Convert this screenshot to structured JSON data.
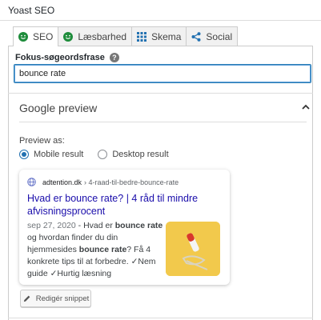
{
  "panel": {
    "title": "Yoast SEO"
  },
  "tabs": [
    {
      "label": "SEO",
      "icon": "smiley-icon",
      "active": true
    },
    {
      "label": "Læsbarhed",
      "icon": "smiley-icon"
    },
    {
      "label": "Skema",
      "icon": "grid-icon"
    },
    {
      "label": "Social",
      "icon": "share-icon"
    }
  ],
  "focus_keyphrase": {
    "label": "Fokus-søgeordsfrase",
    "value": "bounce rate",
    "help_icon": "question-icon"
  },
  "google_preview": {
    "heading": "Google preview",
    "preview_as_label": "Preview as:",
    "options": [
      "Mobile result",
      "Desktop result"
    ],
    "selected": "Mobile result",
    "snippet": {
      "domain": "adtention.dk",
      "path": "› 4-raad-til-bedre-bounce-rate",
      "title": "Hvad er bounce rate? | 4 råd til mindre afvisningsprocent",
      "date": "sep 27, 2020",
      "dash": " - ",
      "desc_1": "Hvad er ",
      "bold_1": "bounce rate",
      "desc_2": " og hvordan finder du din hjemmesides ",
      "bold_2": "bounce rate",
      "desc_3": "? Få 4 konkrete tips til at forbedre. ✓Nem guide ✓Hurtig læsning"
    },
    "edit_button": "Redigér snippet"
  },
  "colors": {
    "accent": "#2271b1",
    "link": "#1a0dab",
    "green_icon": "#1e8c3b",
    "thumb_bg": "#f2c94c"
  }
}
